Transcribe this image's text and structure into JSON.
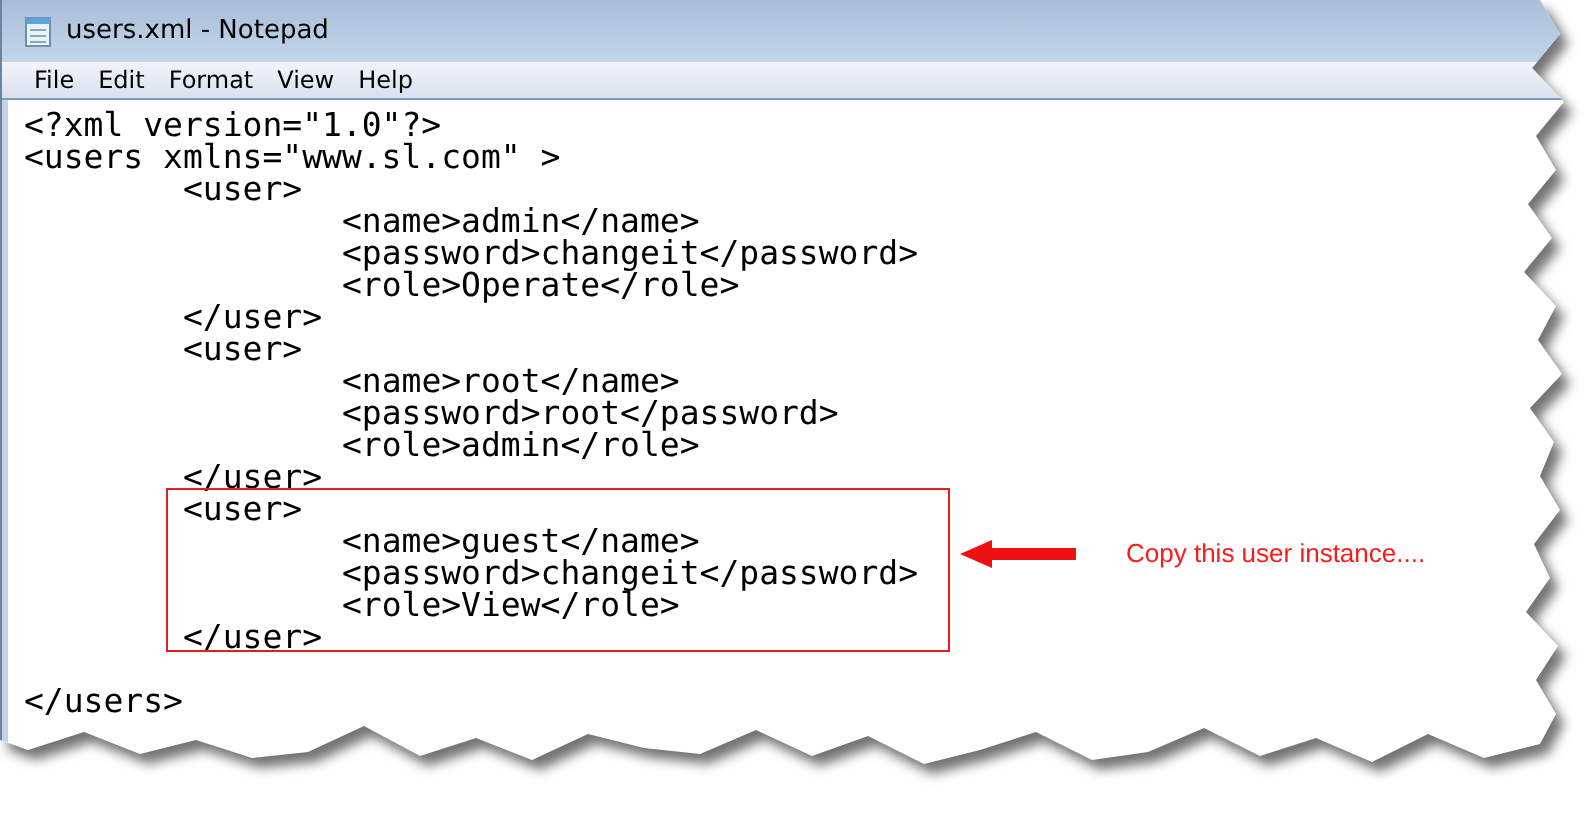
{
  "window": {
    "title": "users.xml - Notepad"
  },
  "menu": [
    {
      "label": "File"
    },
    {
      "label": "Edit"
    },
    {
      "label": "Format"
    },
    {
      "label": "View"
    },
    {
      "label": "Help"
    }
  ],
  "editor": {
    "lines": [
      {
        "kind": "code",
        "text": "<?xml version=\"1.0\"?>"
      },
      {
        "kind": "code",
        "text": "<users xmlns=\"www.sl.com\" >"
      },
      {
        "kind": "code",
        "text": "\t<user>"
      },
      {
        "kind": "code",
        "text": "\t\t<name>admin</name>"
      },
      {
        "kind": "code",
        "text": "\t\t<password>changeit</password>"
      },
      {
        "kind": "code",
        "text": "\t\t<role>Operate</role>"
      },
      {
        "kind": "code",
        "text": "\t</user>"
      },
      {
        "kind": "code",
        "text": "\t<user>"
      },
      {
        "kind": "code",
        "text": "\t\t<name>root</name>"
      },
      {
        "kind": "code",
        "text": "\t\t<password>root</password>"
      },
      {
        "kind": "code",
        "text": "\t\t<role>admin</role>"
      },
      {
        "kind": "code",
        "text": "\t</user>"
      },
      {
        "kind": "code",
        "text": "\t<user>"
      },
      {
        "kind": "code",
        "text": "\t\t<name>guest</name>"
      },
      {
        "kind": "code",
        "text": "\t\t<password>changeit</password>"
      },
      {
        "kind": "code",
        "text": "\t\t<role>View</role>"
      },
      {
        "kind": "code",
        "text": "\t</user>"
      },
      {
        "kind": "blank"
      },
      {
        "kind": "code",
        "text": "</users>"
      }
    ]
  },
  "annotation": {
    "text": "Copy this user instance...."
  }
}
